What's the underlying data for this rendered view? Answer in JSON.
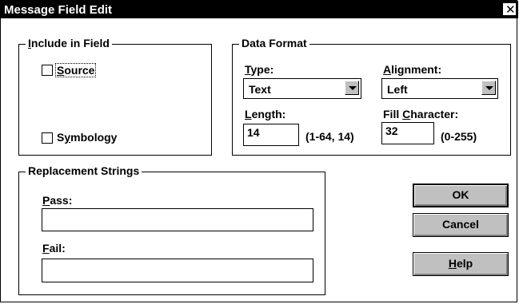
{
  "window": {
    "title": "Message Field Edit",
    "close_glyph": "✕"
  },
  "include_group": {
    "label_letter": "I",
    "label_rest": "nclude in Field",
    "source_letter": "S",
    "source_rest": "ource",
    "symbology_pre": "S",
    "symbology_letter": "y",
    "symbology_rest": "mbology"
  },
  "format_group": {
    "label": "Data Format",
    "type_letter": "T",
    "type_rest": "ype:",
    "type_value": "Text",
    "alignment_letter": "A",
    "alignment_rest": "lignment:",
    "alignment_value": "Left",
    "length_letter": "L",
    "length_rest": "ength:",
    "length_value": "14",
    "length_range": "(1-64, 14)",
    "fill_pre": "Fill ",
    "fill_letter": "C",
    "fill_rest": "haracter:",
    "fill_value": "32",
    "fill_range": "(0-255)"
  },
  "replacement_group": {
    "label": "Replacement Strings",
    "pass_letter": "P",
    "pass_rest": "ass:",
    "pass_value": "",
    "fail_letter": "F",
    "fail_rest": "ail:",
    "fail_value": ""
  },
  "buttons": {
    "ok": "OK",
    "cancel": "Cancel",
    "help_letter": "H",
    "help_rest": "elp"
  }
}
